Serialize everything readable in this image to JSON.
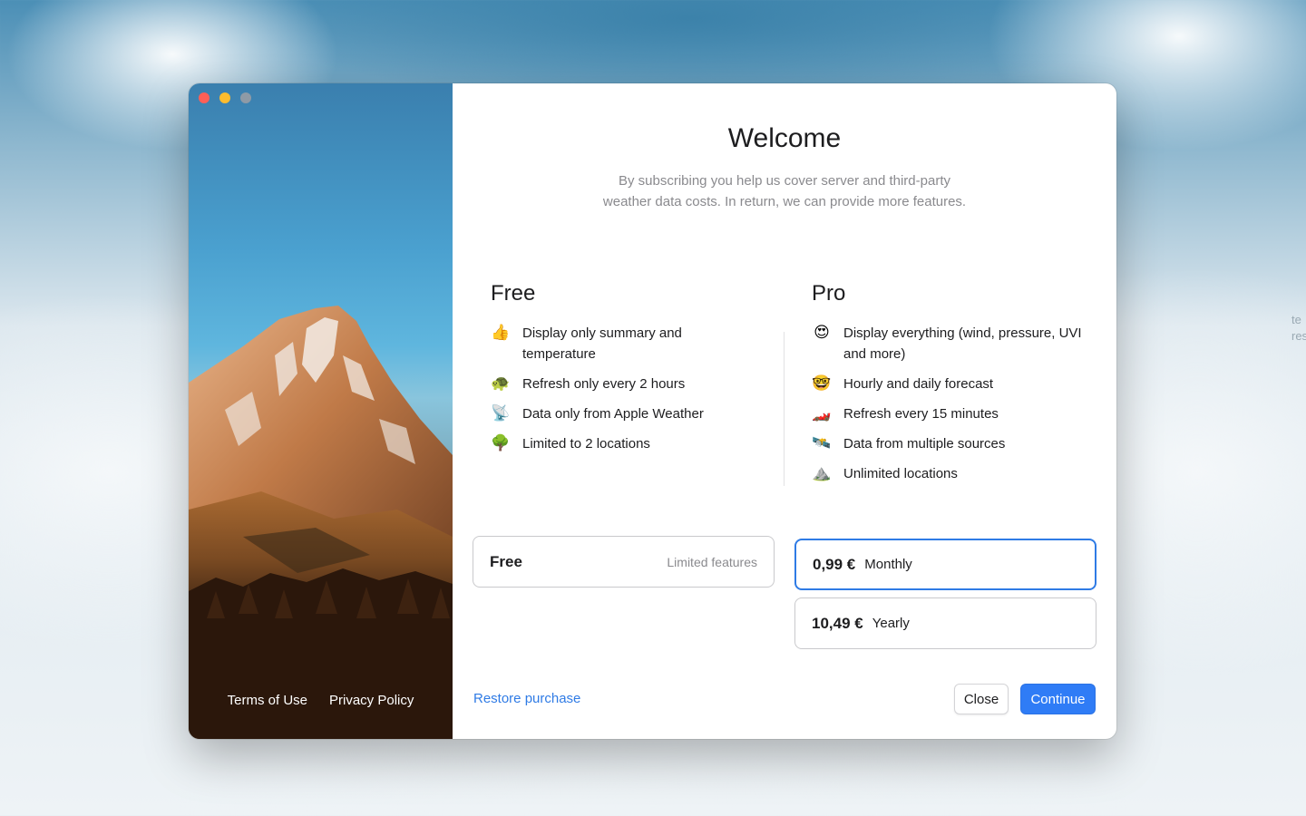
{
  "window": {
    "controls": [
      "close",
      "minimize",
      "zoom"
    ]
  },
  "hero": {
    "terms_label": "Terms of Use",
    "privacy_label": "Privacy Policy"
  },
  "header": {
    "title": "Welcome",
    "subtitle": "By subscribing you help us cover server and third-party weather data costs. In return, we can provide more features."
  },
  "free_column": {
    "heading": "Free",
    "features": [
      {
        "icon": "thumbs-up-icon",
        "glyph": "👍",
        "text": "Display only summary and temperature"
      },
      {
        "icon": "turtle-icon",
        "glyph": "🐢",
        "text": "Refresh only every 2 hours"
      },
      {
        "icon": "satellite-dish-icon",
        "glyph": "📡",
        "text": "Data only from Apple Weather"
      },
      {
        "icon": "tree-icon",
        "glyph": "🌳",
        "text": "Limited to 2 locations"
      }
    ]
  },
  "pro_column": {
    "heading": "Pro",
    "features": [
      {
        "icon": "heart-eyes-icon",
        "glyph": "😍",
        "text": "Display everything (wind, pressure, UVI and more)"
      },
      {
        "icon": "nerd-face-icon",
        "glyph": "🤓",
        "text": "Hourly and daily forecast"
      },
      {
        "icon": "race-car-icon",
        "glyph": "🏎️",
        "text": "Refresh every 15 minutes"
      },
      {
        "icon": "satellite-icon",
        "glyph": "🛰️",
        "text": "Data from multiple sources"
      },
      {
        "icon": "mountain-icon",
        "glyph": "⛰️",
        "text": "Unlimited locations"
      }
    ]
  },
  "plans": {
    "free": {
      "name": "Free",
      "description": "Limited features"
    },
    "monthly": {
      "price": "0,99 €",
      "period": "Monthly",
      "selected": true
    },
    "yearly": {
      "price": "10,49 €",
      "period": "Yearly",
      "selected": false
    }
  },
  "footer": {
    "restore_label": "Restore purchase",
    "close_label": "Close",
    "continue_label": "Continue"
  },
  "side_text": [
    "te",
    "res"
  ],
  "colors": {
    "accent": "#2f7be5",
    "continue_bg": "#2f7cf6",
    "close_dot": "#fe5f57",
    "minimize_dot": "#febc2e",
    "zoom_dot": "#8e9aa6"
  }
}
